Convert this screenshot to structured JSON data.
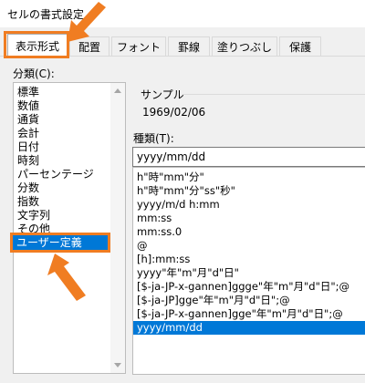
{
  "window": {
    "title": "セルの書式設定"
  },
  "tabs": [
    {
      "label": "表示形式",
      "active": true
    },
    {
      "label": "配置"
    },
    {
      "label": "フォント"
    },
    {
      "label": "罫線"
    },
    {
      "label": "塗りつぶし"
    },
    {
      "label": "保護"
    }
  ],
  "category": {
    "label": "分類(C):",
    "items": [
      "標準",
      "数値",
      "通貨",
      "会計",
      "日付",
      "時刻",
      "パーセンテージ",
      "分数",
      "指数",
      "文字列",
      "その他",
      "ユーザー定義"
    ],
    "selected": "ユーザー定義"
  },
  "sample": {
    "label": "サンプル",
    "value": "1969/02/06"
  },
  "type": {
    "label": "種類(T):",
    "input_value": "yyyy/mm/dd",
    "items": [
      "h\"時\"mm\"分\"",
      "h\"時\"mm\"分\"ss\"秒\"",
      "yyyy/m/d h:mm",
      "mm:ss",
      "mm:ss.0",
      "@",
      "[h]:mm:ss",
      "yyyy\"年\"m\"月\"d\"日\"",
      "[$-ja-JP-x-gannen]ggge\"年\"m\"月\"d\"日\";@",
      "[$-ja-JP]gge\"年\"m\"月\"d\"日\";@",
      "[$-ja-JP-x-gannen]gge\"年\"m\"月\"d\"日\";@",
      "yyyy/mm/dd"
    ],
    "selected": "yyyy/mm/dd"
  },
  "colors": {
    "accent": "#0078d7",
    "highlight": "#f07d22"
  }
}
